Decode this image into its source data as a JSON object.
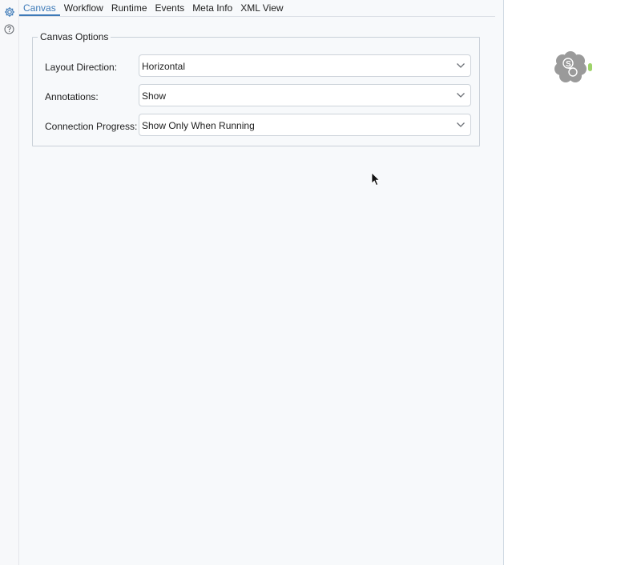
{
  "tabs": [
    {
      "label": "Canvas",
      "active": true
    },
    {
      "label": "Workflow"
    },
    {
      "label": "Runtime"
    },
    {
      "label": "Events"
    },
    {
      "label": "Meta Info"
    },
    {
      "label": "XML View"
    }
  ],
  "sidebar": {
    "icons": [
      "gear-icon",
      "help-icon"
    ]
  },
  "canvas_options": {
    "title": "Canvas Options",
    "layout_direction": {
      "label": "Layout Direction:",
      "value": "Horizontal"
    },
    "annotations": {
      "label": "Annotations:",
      "value": "Show"
    },
    "connection_progress": {
      "label": "Connection Progress:",
      "value": "Show Only When Running"
    }
  },
  "canvas": {
    "tool_icon": "sharepoint-tool-icon",
    "tool_letter": "S"
  },
  "colors": {
    "accent": "#3d7ab8",
    "tool_gray": "#9a9a9a",
    "anchor_green": "#9ed36a"
  }
}
